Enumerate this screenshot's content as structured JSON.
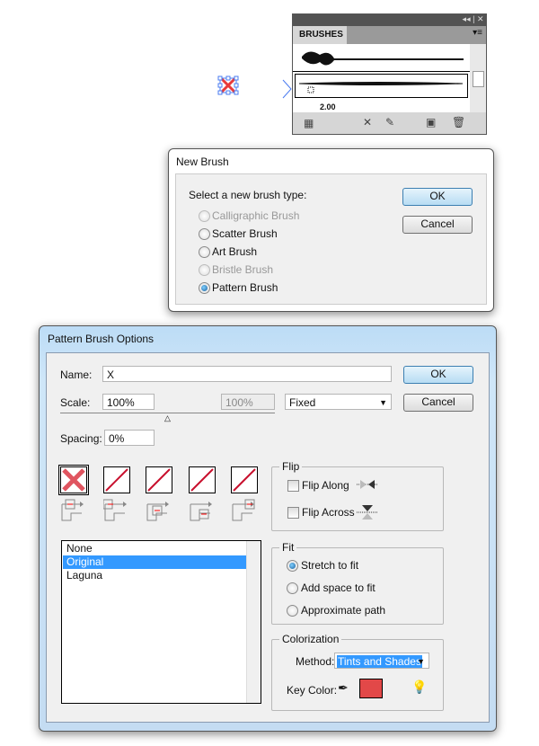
{
  "brushes_panel": {
    "tab": "BRUSHES",
    "partial_row_text": "2.00"
  },
  "new_brush": {
    "title": "New Brush",
    "prompt": "Select a new brush type:",
    "options": [
      {
        "label": "Calligraphic Brush",
        "enabled": false,
        "selected": false
      },
      {
        "label": "Scatter Brush",
        "enabled": true,
        "selected": false
      },
      {
        "label": "Art Brush",
        "enabled": true,
        "selected": false
      },
      {
        "label": "Bristle Brush",
        "enabled": false,
        "selected": false
      },
      {
        "label": "Pattern Brush",
        "enabled": true,
        "selected": true
      }
    ],
    "ok": "OK",
    "cancel": "Cancel"
  },
  "pattern": {
    "title": "Pattern Brush Options",
    "name_label": "Name:",
    "name_value": "X",
    "scale_label": "Scale:",
    "scale_value": "100%",
    "scale_max": "100%",
    "scale_mode": "Fixed",
    "spacing_label": "Spacing:",
    "spacing_value": "0%",
    "ok": "OK",
    "cancel": "Cancel",
    "tiles": [
      "side-tile",
      "outer-corner-tile",
      "inner-corner-tile",
      "start-tile",
      "end-tile"
    ],
    "patterns": [
      "None",
      "Original",
      "Laguna"
    ],
    "selected_pattern": "Original",
    "flip": {
      "title": "Flip",
      "along": "Flip Along",
      "across": "Flip Across",
      "along_checked": false,
      "across_checked": false
    },
    "fit": {
      "title": "Fit",
      "options": [
        "Stretch to fit",
        "Add space to fit",
        "Approximate path"
      ],
      "selected": "Stretch to fit"
    },
    "colorization": {
      "title": "Colorization",
      "method_label": "Method:",
      "method_value": "Tints and Shades",
      "key_color_label": "Key Color:",
      "key_color": "#e24848"
    }
  },
  "colors": {
    "accent": "#3399ff",
    "tile_stroke": "#c8102e"
  }
}
